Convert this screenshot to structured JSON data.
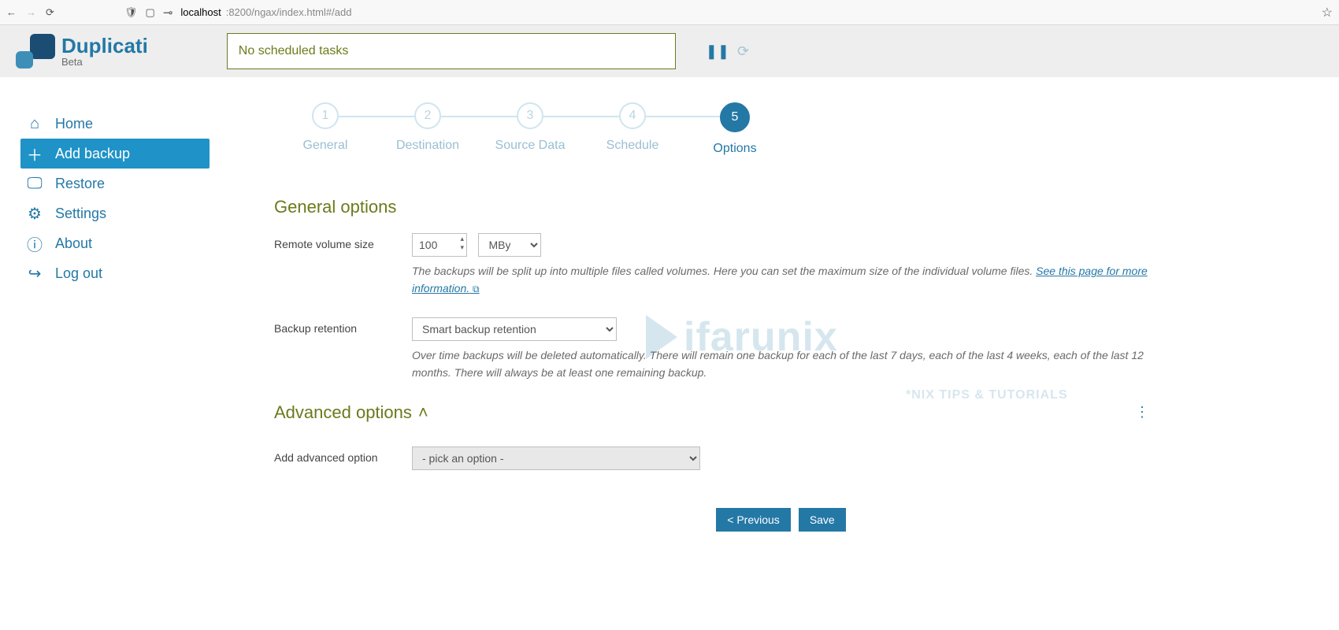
{
  "browser": {
    "url_host": "localhost",
    "url_path": ":8200/ngax/index.html#/add"
  },
  "app": {
    "name": "Duplicati",
    "tag": "Beta",
    "status": "No scheduled tasks"
  },
  "sidebar": {
    "items": [
      {
        "label": "Home",
        "active": false
      },
      {
        "label": "Add backup",
        "active": true
      },
      {
        "label": "Restore",
        "active": false
      },
      {
        "label": "Settings",
        "active": false
      },
      {
        "label": "About",
        "active": false
      },
      {
        "label": "Log out",
        "active": false
      }
    ]
  },
  "stepper": {
    "steps": [
      {
        "num": "1",
        "label": "General"
      },
      {
        "num": "2",
        "label": "Destination"
      },
      {
        "num": "3",
        "label": "Source Data"
      },
      {
        "num": "4",
        "label": "Schedule"
      },
      {
        "num": "5",
        "label": "Options"
      }
    ],
    "active_index": 4
  },
  "sections": {
    "general": {
      "title": "General options",
      "volume_label": "Remote volume size",
      "volume_value": "100",
      "volume_unit": "MByte",
      "volume_help_pre": "The backups will be split up into multiple files called volumes. Here you can set the maximum size of the individual volume files. ",
      "volume_help_link": "See this page for more information.",
      "retention_label": "Backup retention",
      "retention_value": "Smart backup retention",
      "retention_help": "Over time backups will be deleted automatically. There will remain one backup for each of the last 7 days, each of the last 4 weeks, each of the last 12 months. There will always be at least one remaining backup."
    },
    "advanced": {
      "title": "Advanced options",
      "add_label": "Add advanced option",
      "add_value": "- pick an option -"
    }
  },
  "buttons": {
    "prev": "< Previous",
    "save": "Save"
  },
  "watermark": {
    "main": "ifarunix",
    "sub": "*NIX TIPS & TUTORIALS"
  }
}
